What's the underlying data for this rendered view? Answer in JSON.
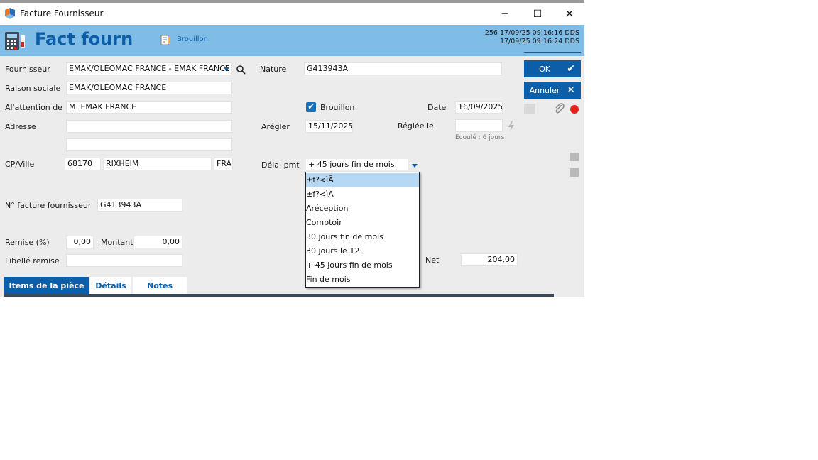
{
  "window": {
    "title": "Facture Fournisseur",
    "minimize": "─",
    "maximize": "☐",
    "close": "✕"
  },
  "header": {
    "title": "Fact fourn",
    "status": "Brouillon",
    "meta_line1": "256  17/09/25 09:16:16 DDS",
    "meta_line2": "17/09/25 09:16:24 DDS"
  },
  "form": {
    "fournisseur_label": "Fournisseur",
    "fournisseur_value": "EMAK/OLEOMAC FRANCE - EMAK FRANCE",
    "raison_label": "Raison sociale",
    "raison_value": "EMAK/OLEOMAC FRANCE",
    "attention_label": "Al'attention de",
    "attention_value": "M. EMAK FRANCE",
    "adresse_label": "Adresse",
    "adresse1_value": "",
    "adresse2_value": "",
    "cpville_label": "CP/Ville",
    "cp_value": "68170",
    "ville_value": "RIXHEIM",
    "pays_value": "FRA",
    "nfacture_label": "N° facture fournisseur",
    "nfacture_value": "G413943A",
    "remise_label": "Remise (%)",
    "remise_value": "0,00",
    "montant_label": "Montant",
    "montant_value": "0,00",
    "libelle_label": "Libellé remise",
    "libelle_value": "",
    "nature_label": "Nature",
    "nature_value": "G413943A",
    "brouillon_label": "Brouillon",
    "brouillon_checked": true,
    "date_label": "Date",
    "date_value": "16/09/2025",
    "aregler_label": "Arégler",
    "aregler_value": "15/11/2025",
    "reglee_label": "Réglée le",
    "reglee_value": "",
    "ecoule_text": "Ecoulé : 6 jours",
    "delai_label": "Délai pmt",
    "delai_value": "+ 45 jours fin de mois",
    "net_label": "Net",
    "net_value": "204,00"
  },
  "buttons": {
    "ok": "OK",
    "ok_icon": "✔",
    "cancel": "Annuler",
    "cancel_icon": "✕"
  },
  "dropdown": {
    "options": [
      "±f?<ìÃ",
      "±f?<ìÃ",
      "Aréception",
      "Comptoir",
      "30 jours fin de mois",
      "30 jours le 12",
      "+ 45 jours fin de mois",
      "Fin de mois"
    ],
    "selected_index": 0
  },
  "tabs": [
    "Items de la pièce",
    "Détails",
    "Notes"
  ],
  "colors": {
    "accent": "#0d5ea8",
    "header_bg": "#7fbde6",
    "window_bg": "#ececec",
    "selection": "#b5d8f5",
    "record": "#e3241b"
  },
  "icons": {
    "app": "app-logo-icon",
    "calc": "calculator-icon",
    "status": "draft-icon",
    "search": "search-icon",
    "attach": "paperclip-icon",
    "lightning": "lightning-icon"
  }
}
